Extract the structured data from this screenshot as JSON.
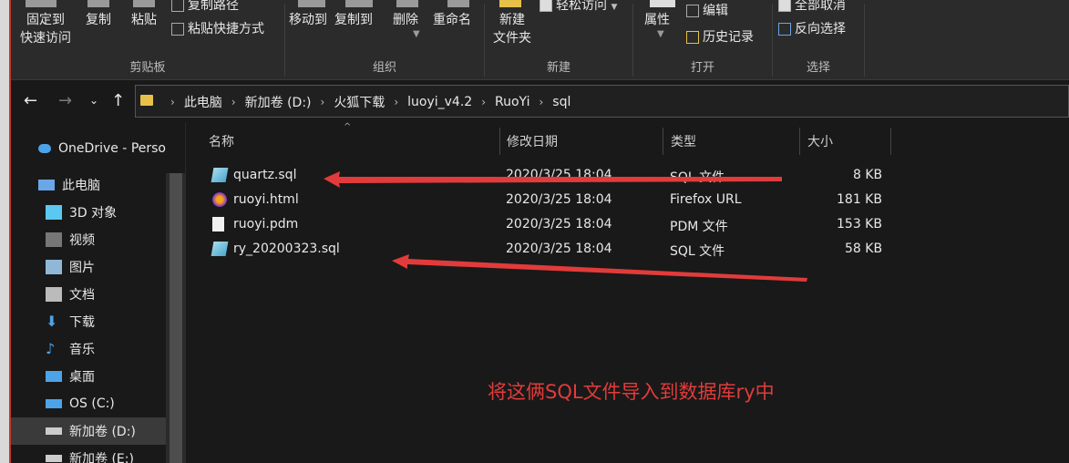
{
  "ribbon": {
    "clipboard": {
      "pin": "固定到",
      "pin2": "快速访问",
      "copy": "复制",
      "paste": "粘贴",
      "copy_path": "复制路径",
      "paste_shortcut": "粘贴快捷方式",
      "label": "剪贴板"
    },
    "organize": {
      "move_to": "移动到",
      "copy_to": "复制到",
      "delete": "删除",
      "rename": "重命名",
      "label": "组织"
    },
    "new": {
      "new_folder": "新建",
      "new_folder2": "文件夹",
      "easy_access": "轻松访问",
      "label": "新建"
    },
    "open": {
      "properties": "属性",
      "edit": "编辑",
      "history": "历史记录",
      "label": "打开"
    },
    "select": {
      "select_none": "全部取消",
      "invert": "反向选择",
      "label": "选择"
    }
  },
  "address": {
    "crumbs": [
      "此电脑",
      "新加卷 (D:)",
      "火狐下载",
      "luoyi_v4.2",
      "RuoYi",
      "sql"
    ]
  },
  "nav": {
    "items": [
      "OneDrive - Perso",
      "此电脑",
      "3D 对象",
      "视频",
      "图片",
      "文档",
      "下载",
      "音乐",
      "桌面",
      "OS (C:)",
      "新加卷 (D:)",
      "新加卷 (E:)"
    ]
  },
  "columns": {
    "name": "名称",
    "date": "修改日期",
    "type": "类型",
    "size": "大小"
  },
  "files": [
    {
      "name": "quartz.sql",
      "date": "2020/3/25 18:04",
      "type": "SQL 文件",
      "size": "8 KB"
    },
    {
      "name": "ruoyi.html",
      "date": "2020/3/25 18:04",
      "type": "Firefox URL",
      "size": "181 KB"
    },
    {
      "name": "ruoyi.pdm",
      "date": "2020/3/25 18:04",
      "type": "PDM 文件",
      "size": "153 KB"
    },
    {
      "name": "ry_20200323.sql",
      "date": "2020/3/25 18:04",
      "type": "SQL 文件",
      "size": "58 KB"
    }
  ],
  "annotation": "将这俩SQL文件导入到数据库ry中",
  "colors": {
    "arrow": "#e23b3b",
    "background": "#191919"
  }
}
